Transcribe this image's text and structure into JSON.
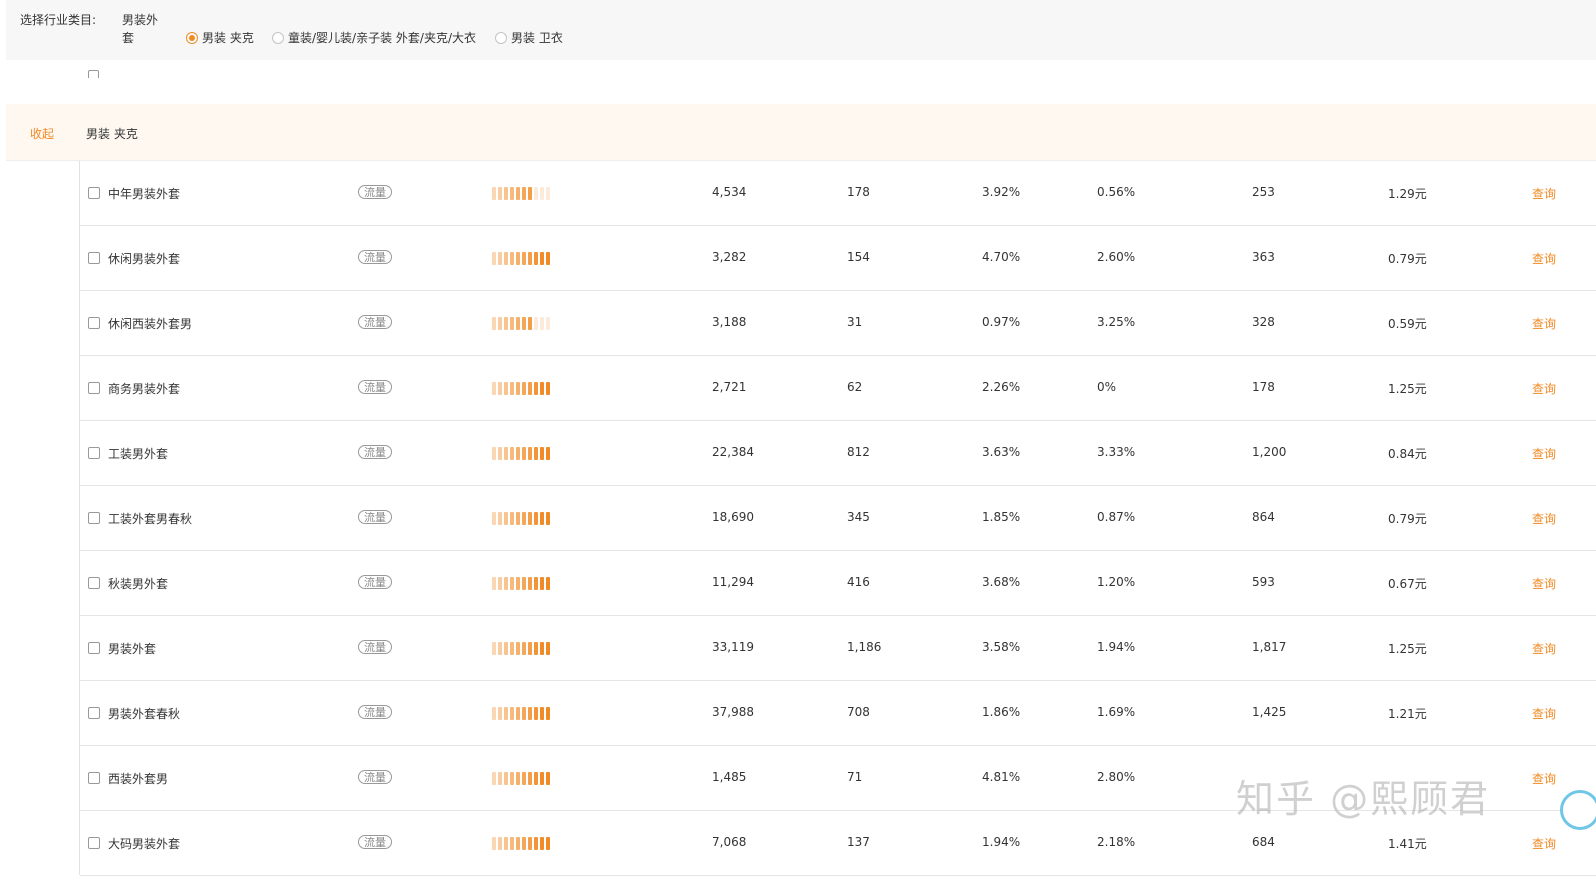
{
  "filter": {
    "label": "选择行业类目:",
    "category": "男装外套",
    "options": [
      {
        "label": "男装 夹克",
        "checked": true
      },
      {
        "label": "童装/婴儿装/亲子装 外套/夹克/大衣",
        "checked": false
      },
      {
        "label": "男装 卫衣",
        "checked": false
      }
    ]
  },
  "group": {
    "collapse_label": "收起",
    "name": "男装 夹克"
  },
  "colors": {
    "accent": "#f08a24",
    "group_bg": "#fef8f1",
    "bar_on": "#f08a24",
    "bar_off": "#fbe3cc"
  },
  "rows": [
    {
      "keyword": "中年男装外套",
      "reason": "流量",
      "level": 7,
      "impressions": "4,534",
      "clicks": "178",
      "ctr": "3.92%",
      "cvr": "0.56%",
      "competition": "253",
      "price": "1.29元",
      "action": "查询"
    },
    {
      "keyword": "休闲男装外套",
      "reason": "流量",
      "level": 10,
      "impressions": "3,282",
      "clicks": "154",
      "ctr": "4.70%",
      "cvr": "2.60%",
      "competition": "363",
      "price": "0.79元",
      "action": "查询"
    },
    {
      "keyword": "休闲西装外套男",
      "reason": "流量",
      "level": 7,
      "impressions": "3,188",
      "clicks": "31",
      "ctr": "0.97%",
      "cvr": "3.25%",
      "competition": "328",
      "price": "0.59元",
      "action": "查询"
    },
    {
      "keyword": "商务男装外套",
      "reason": "流量",
      "level": 10,
      "impressions": "2,721",
      "clicks": "62",
      "ctr": "2.26%",
      "cvr": "0%",
      "competition": "178",
      "price": "1.25元",
      "action": "查询"
    },
    {
      "keyword": "工装男外套",
      "reason": "流量",
      "level": 10,
      "impressions": "22,384",
      "clicks": "812",
      "ctr": "3.63%",
      "cvr": "3.33%",
      "competition": "1,200",
      "price": "0.84元",
      "action": "查询"
    },
    {
      "keyword": "工装外套男春秋",
      "reason": "流量",
      "level": 10,
      "impressions": "18,690",
      "clicks": "345",
      "ctr": "1.85%",
      "cvr": "0.87%",
      "competition": "864",
      "price": "0.79元",
      "action": "查询"
    },
    {
      "keyword": "秋装男外套",
      "reason": "流量",
      "level": 10,
      "impressions": "11,294",
      "clicks": "416",
      "ctr": "3.68%",
      "cvr": "1.20%",
      "competition": "593",
      "price": "0.67元",
      "action": "查询"
    },
    {
      "keyword": "男装外套",
      "reason": "流量",
      "level": 10,
      "impressions": "33,119",
      "clicks": "1,186",
      "ctr": "3.58%",
      "cvr": "1.94%",
      "competition": "1,817",
      "price": "1.25元",
      "action": "查询"
    },
    {
      "keyword": "男装外套春秋",
      "reason": "流量",
      "level": 10,
      "impressions": "37,988",
      "clicks": "708",
      "ctr": "1.86%",
      "cvr": "1.69%",
      "competition": "1,425",
      "price": "1.21元",
      "action": "查询"
    },
    {
      "keyword": "西装外套男",
      "reason": "流量",
      "level": 10,
      "impressions": "1,485",
      "clicks": "71",
      "ctr": "4.81%",
      "cvr": "2.80%",
      "competition": "",
      "price": "",
      "action": "查询"
    },
    {
      "keyword": "大码男装外套",
      "reason": "流量",
      "level": 10,
      "impressions": "7,068",
      "clicks": "137",
      "ctr": "1.94%",
      "cvr": "2.18%",
      "competition": "684",
      "price": "1.41元",
      "action": "查询"
    }
  ],
  "watermark": "知乎 @熙顾君"
}
